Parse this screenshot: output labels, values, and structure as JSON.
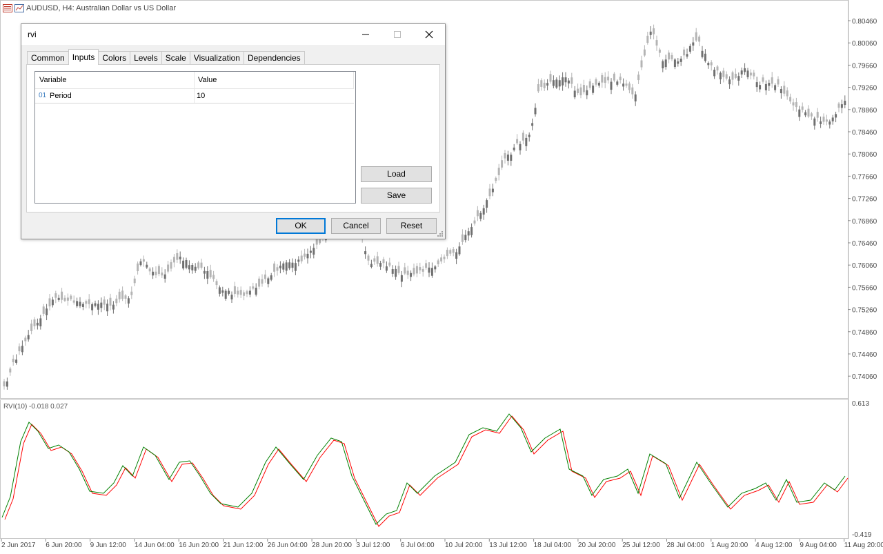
{
  "chart": {
    "title": "AUDUSD, H4:  Australian Dollar vs US Dollar",
    "price_labels": [
      "0.80460",
      "0.80060",
      "0.79660",
      "0.79260",
      "0.78860",
      "0.78460",
      "0.78060",
      "0.77660",
      "0.77260",
      "0.76860",
      "0.76460",
      "0.76060",
      "0.75660",
      "0.75260",
      "0.74860",
      "0.74460",
      "0.74060"
    ],
    "time_labels": [
      "2 Jun 2017",
      "6 Jun 20:00",
      "9 Jun 12:00",
      "14 Jun 04:00",
      "16 Jun 20:00",
      "21 Jun 12:00",
      "26 Jun 04:00",
      "28 Jun 20:00",
      "3 Jul 12:00",
      "6 Jul 04:00",
      "10 Jul 20:00",
      "13 Jul 12:00",
      "18 Jul 04:00",
      "20 Jul 20:00",
      "25 Jul 12:00",
      "28 Jul 04:00",
      "1 Aug 20:00",
      "4 Aug 12:00",
      "9 Aug 04:00",
      "11 Aug 20:00"
    ],
    "indicator_label": "RVI(10) -0.018 0.027",
    "indicator_max": "0.613",
    "indicator_min": "-0.419",
    "colors": {
      "candle_bull": "#b4b4b4",
      "candle_bear": "#707070",
      "rvi_main": "#008000",
      "rvi_signal": "#ff0000",
      "grid_border": "#c8c8c8"
    }
  },
  "dialog": {
    "title": "rvi",
    "tabs": [
      "Common",
      "Inputs",
      "Colors",
      "Levels",
      "Scale",
      "Visualization",
      "Dependencies"
    ],
    "active_tab": "Inputs",
    "columns": {
      "variable": "Variable",
      "value": "Value"
    },
    "rows": [
      {
        "badge": "01",
        "name": "Period",
        "value": "10"
      }
    ],
    "load_label": "Load",
    "save_label": "Save",
    "ok_label": "OK",
    "cancel_label": "Cancel",
    "reset_label": "Reset",
    "icons": {
      "minimize": "minimize-icon",
      "maximize": "maximize-icon",
      "close": "close-icon",
      "resize": "resize-grip-icon"
    }
  }
}
